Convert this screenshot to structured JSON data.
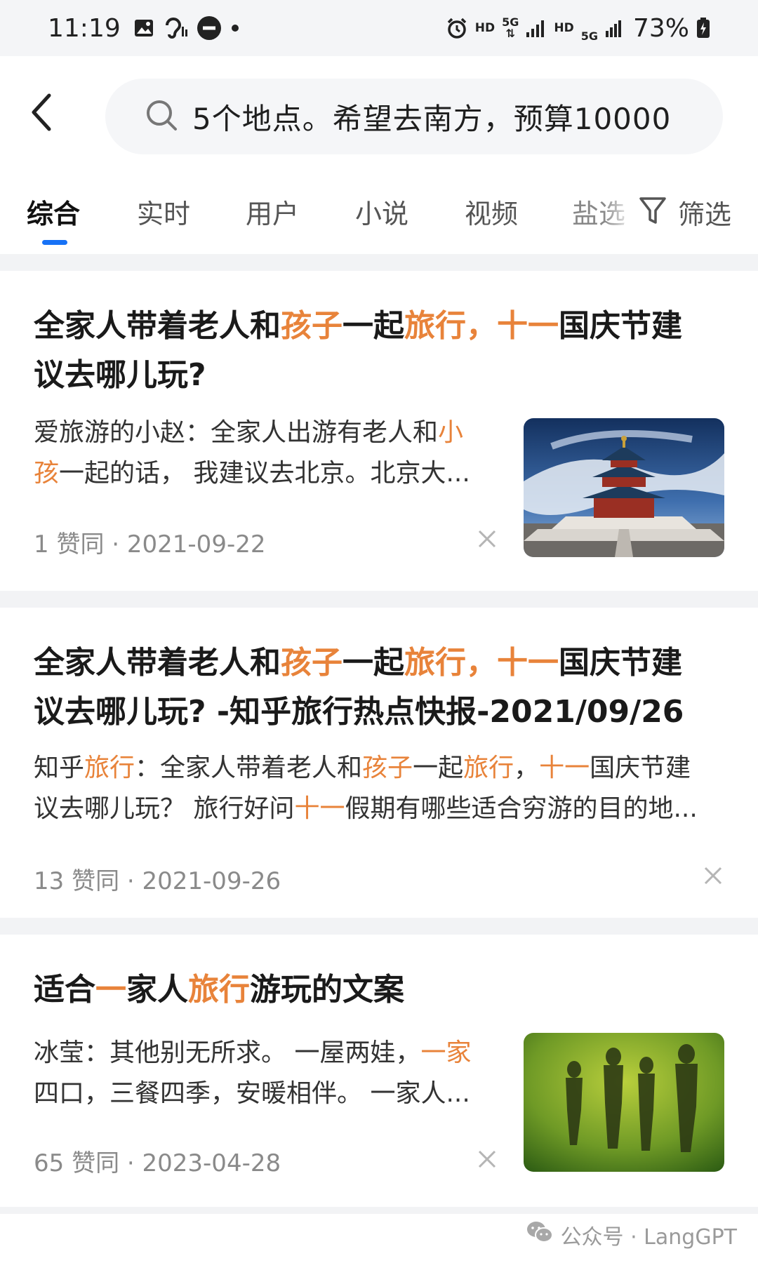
{
  "status_bar": {
    "time": "11:19",
    "hd1": "HD",
    "net1": "5G",
    "hd2": "HD",
    "net2": "5G",
    "battery": "73%"
  },
  "search": {
    "query": "5个地点。希望去南方，预算10000"
  },
  "tabs": [
    {
      "label": "综合",
      "active": true
    },
    {
      "label": "实时"
    },
    {
      "label": "用户"
    },
    {
      "label": "小说"
    },
    {
      "label": "视频"
    },
    {
      "label": "盐选"
    }
  ],
  "filter_label": "筛选",
  "results": [
    {
      "title_line1": [
        "全家人带着老人和",
        "孩子",
        "一起",
        "旅行，十一",
        "国庆节建"
      ],
      "title_line2": "议去哪儿玩?",
      "snippet_line1": [
        "爱旅游的小赵：全家人出游有老人和",
        "小"
      ],
      "snippet_line2": [
        "孩",
        "一起的话， 我建议去北京。北京大..."
      ],
      "likes": "1 赞同",
      "date": "2021-09-22"
    },
    {
      "title_line1": [
        "全家人带着老人和",
        "孩子",
        "一起",
        "旅行，十一",
        "国庆节建"
      ],
      "title_line2": "议去哪儿玩? -知乎旅行热点快报-2021/09/26",
      "snippet_line1": [
        "知乎",
        "旅行",
        "：全家人带着老人和",
        "孩子",
        "一起",
        "旅行",
        "，",
        "十一",
        "国庆节建"
      ],
      "snippet_line2": [
        "议去哪儿玩？ 旅行好问",
        "十一",
        "假期有哪些适合穷游的目的地..."
      ],
      "likes": "13 赞同",
      "date": "2021-09-26"
    },
    {
      "title_line1": [
        "适合",
        "一",
        "家人",
        "旅行",
        "游玩的文案"
      ],
      "snippet_line1": [
        "冰莹：其他别无所求。 一屋两娃，",
        "一家"
      ],
      "snippet_line2": "四口，三餐四季，安暖相伴。 一家人...",
      "likes": "65 赞同",
      "date": "2023-04-28"
    }
  ],
  "meta_sep": " · ",
  "watermark": "公众号 · LangGPT",
  "colors": {
    "highlight": "#e8833a",
    "tab_indicator": "#1772f6",
    "separator": "#f2f3f5"
  }
}
